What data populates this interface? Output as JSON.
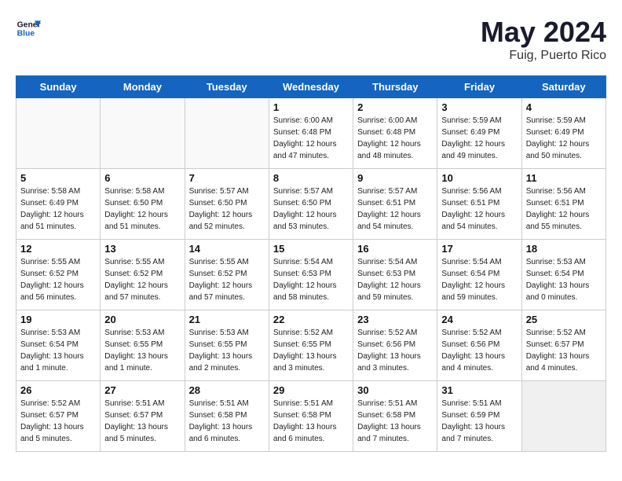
{
  "header": {
    "logo_line1": "General",
    "logo_line2": "Blue",
    "title": "May 2024",
    "subtitle": "Fuig, Puerto Rico"
  },
  "days_of_week": [
    "Sunday",
    "Monday",
    "Tuesday",
    "Wednesday",
    "Thursday",
    "Friday",
    "Saturday"
  ],
  "weeks": [
    [
      {
        "day": "",
        "empty": true
      },
      {
        "day": "",
        "empty": true
      },
      {
        "day": "",
        "empty": true
      },
      {
        "day": "1",
        "sunrise": "6:00 AM",
        "sunset": "6:48 PM",
        "daylight": "12 hours and 47 minutes."
      },
      {
        "day": "2",
        "sunrise": "6:00 AM",
        "sunset": "6:48 PM",
        "daylight": "12 hours and 48 minutes."
      },
      {
        "day": "3",
        "sunrise": "5:59 AM",
        "sunset": "6:49 PM",
        "daylight": "12 hours and 49 minutes."
      },
      {
        "day": "4",
        "sunrise": "5:59 AM",
        "sunset": "6:49 PM",
        "daylight": "12 hours and 50 minutes."
      }
    ],
    [
      {
        "day": "5",
        "sunrise": "5:58 AM",
        "sunset": "6:49 PM",
        "daylight": "12 hours and 51 minutes."
      },
      {
        "day": "6",
        "sunrise": "5:58 AM",
        "sunset": "6:50 PM",
        "daylight": "12 hours and 51 minutes."
      },
      {
        "day": "7",
        "sunrise": "5:57 AM",
        "sunset": "6:50 PM",
        "daylight": "12 hours and 52 minutes."
      },
      {
        "day": "8",
        "sunrise": "5:57 AM",
        "sunset": "6:50 PM",
        "daylight": "12 hours and 53 minutes."
      },
      {
        "day": "9",
        "sunrise": "5:57 AM",
        "sunset": "6:51 PM",
        "daylight": "12 hours and 54 minutes."
      },
      {
        "day": "10",
        "sunrise": "5:56 AM",
        "sunset": "6:51 PM",
        "daylight": "12 hours and 54 minutes."
      },
      {
        "day": "11",
        "sunrise": "5:56 AM",
        "sunset": "6:51 PM",
        "daylight": "12 hours and 55 minutes."
      }
    ],
    [
      {
        "day": "12",
        "sunrise": "5:55 AM",
        "sunset": "6:52 PM",
        "daylight": "12 hours and 56 minutes."
      },
      {
        "day": "13",
        "sunrise": "5:55 AM",
        "sunset": "6:52 PM",
        "daylight": "12 hours and 57 minutes."
      },
      {
        "day": "14",
        "sunrise": "5:55 AM",
        "sunset": "6:52 PM",
        "daylight": "12 hours and 57 minutes."
      },
      {
        "day": "15",
        "sunrise": "5:54 AM",
        "sunset": "6:53 PM",
        "daylight": "12 hours and 58 minutes."
      },
      {
        "day": "16",
        "sunrise": "5:54 AM",
        "sunset": "6:53 PM",
        "daylight": "12 hours and 59 minutes."
      },
      {
        "day": "17",
        "sunrise": "5:54 AM",
        "sunset": "6:54 PM",
        "daylight": "12 hours and 59 minutes."
      },
      {
        "day": "18",
        "sunrise": "5:53 AM",
        "sunset": "6:54 PM",
        "daylight": "13 hours and 0 minutes."
      }
    ],
    [
      {
        "day": "19",
        "sunrise": "5:53 AM",
        "sunset": "6:54 PM",
        "daylight": "13 hours and 1 minute."
      },
      {
        "day": "20",
        "sunrise": "5:53 AM",
        "sunset": "6:55 PM",
        "daylight": "13 hours and 1 minute."
      },
      {
        "day": "21",
        "sunrise": "5:53 AM",
        "sunset": "6:55 PM",
        "daylight": "13 hours and 2 minutes."
      },
      {
        "day": "22",
        "sunrise": "5:52 AM",
        "sunset": "6:55 PM",
        "daylight": "13 hours and 3 minutes."
      },
      {
        "day": "23",
        "sunrise": "5:52 AM",
        "sunset": "6:56 PM",
        "daylight": "13 hours and 3 minutes."
      },
      {
        "day": "24",
        "sunrise": "5:52 AM",
        "sunset": "6:56 PM",
        "daylight": "13 hours and 4 minutes."
      },
      {
        "day": "25",
        "sunrise": "5:52 AM",
        "sunset": "6:57 PM",
        "daylight": "13 hours and 4 minutes."
      }
    ],
    [
      {
        "day": "26",
        "sunrise": "5:52 AM",
        "sunset": "6:57 PM",
        "daylight": "13 hours and 5 minutes."
      },
      {
        "day": "27",
        "sunrise": "5:51 AM",
        "sunset": "6:57 PM",
        "daylight": "13 hours and 5 minutes."
      },
      {
        "day": "28",
        "sunrise": "5:51 AM",
        "sunset": "6:58 PM",
        "daylight": "13 hours and 6 minutes."
      },
      {
        "day": "29",
        "sunrise": "5:51 AM",
        "sunset": "6:58 PM",
        "daylight": "13 hours and 6 minutes."
      },
      {
        "day": "30",
        "sunrise": "5:51 AM",
        "sunset": "6:58 PM",
        "daylight": "13 hours and 7 minutes."
      },
      {
        "day": "31",
        "sunrise": "5:51 AM",
        "sunset": "6:59 PM",
        "daylight": "13 hours and 7 minutes."
      },
      {
        "day": "",
        "empty": true,
        "shaded": true
      }
    ]
  ]
}
